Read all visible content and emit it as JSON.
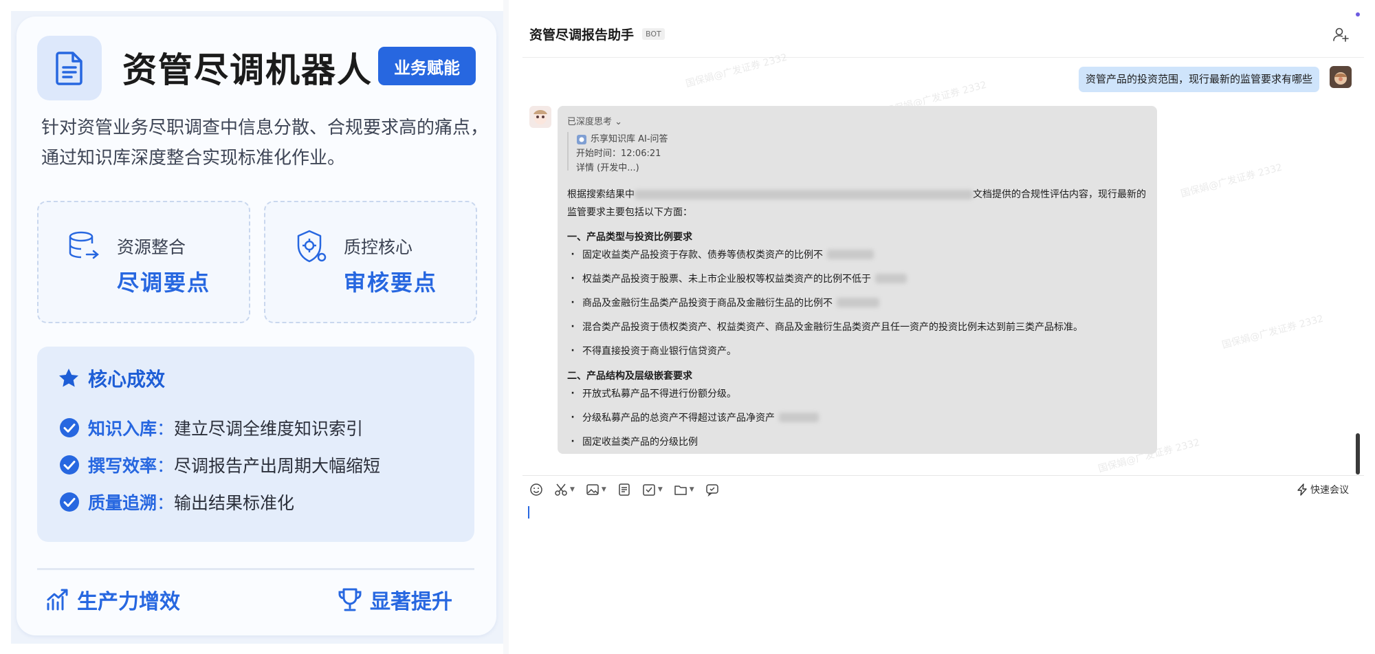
{
  "left": {
    "title": "资管尽调机器人",
    "badge": "业务赋能",
    "description": "针对资管业务尽职调查中信息分散、合规要求高的痛点，通过知识库深度整合实现标准化作业。",
    "tiles": [
      {
        "label": "资源整合",
        "value": "尽调要点"
      },
      {
        "label": "质控核心",
        "value": "审核要点"
      }
    ],
    "effects": {
      "title": "核心成效",
      "items": [
        {
          "key": "知识入库",
          "value": "建立尽调全维度知识索引"
        },
        {
          "key": "撰写效率",
          "value": "尽调报告产出周期大幅缩短"
        },
        {
          "key": "质量追溯",
          "value": "输出结果标准化"
        }
      ]
    },
    "footer": {
      "left": "生产力增效",
      "right": "显著提升"
    },
    "accent_color": "#2767e0"
  },
  "chat": {
    "bot_name": "资管尽调报告助手",
    "bot_tag": "BOT",
    "watermark": "国保娟@广发证券 2332",
    "user_message": "资管产品的投资范围，现行最新的监管要求有哪些",
    "reply": {
      "thinking_label": "已深度思考",
      "tool_name": "乐享知识库 AI-问答",
      "start_time": "开始时间：12:06:21",
      "details": "详情 (开发中...)",
      "intro_prefix": "根据搜索结果中",
      "intro_suffix": "文档提供的合规性评估内容，现行最新的监管要求主要包括以下方面：",
      "section1_title": "一、产品类型与投资比例要求",
      "section1_items": [
        "固定收益类产品投资于存款、债券等债权类资产的比例不",
        "权益类产品投资于股票、未上市企业股权等权益类资产的比例不低于",
        "商品及金融衍生品类产品投资于商品及金融衍生品的比例不",
        "混合类产品投资于债权类资产、权益类资产、商品及金融衍生品类资产且任一资产的投资比例未达到前三类产品标准。",
        "不得直接投资于商业银行信贷资产。"
      ],
      "section2_title": "二、产品结构及层级嵌套要求",
      "section2_items": [
        "开放式私募产品不得进行份额分级。",
        "分级私募产品的总资产不得超过该产品净资产",
        "固定收益类产品的分级比例"
      ]
    },
    "toolbar": {
      "icons": [
        "emoji-icon",
        "scissors-icon",
        "image-icon",
        "doc-icon",
        "task-icon",
        "folder-icon",
        "chat-icon"
      ],
      "quick_meeting": "快速会议"
    }
  }
}
